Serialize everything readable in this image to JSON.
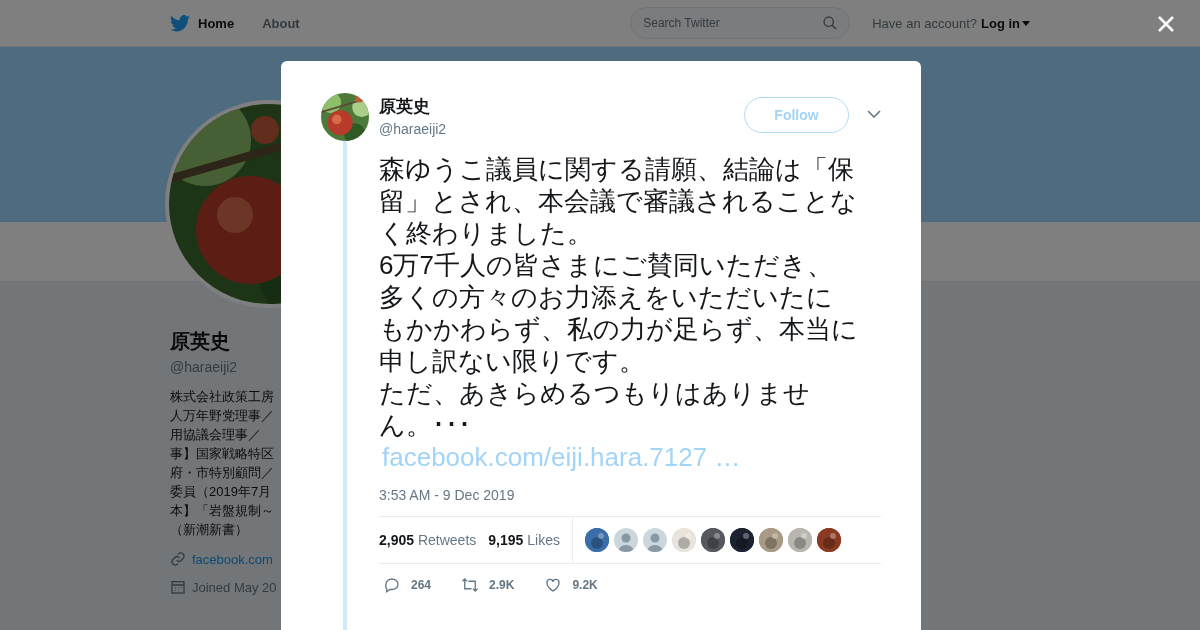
{
  "header": {
    "nav": [
      {
        "label": "Home",
        "selected": true
      },
      {
        "label": "About",
        "selected": false
      }
    ],
    "search": {
      "placeholder": "Search Twitter"
    },
    "account_prompt": "Have an account?",
    "login": "Log in"
  },
  "profile": {
    "name": "原英史",
    "handle": "@haraeiji2",
    "bio_lines": [
      "株式会社政策工房",
      "人万年野党理事／",
      "用協議会理事／",
      "事】国家戦略特区",
      "府・市特別顧問／",
      "委員（2019年7月",
      "本】「岩盤規制～",
      "（新潮新書）"
    ],
    "link": "facebook.com",
    "joined": "Joined May 20"
  },
  "tweet": {
    "name": "原英史",
    "handle": "@haraeiji2",
    "follow": "Follow",
    "paragraphs": [
      "森ゆうこ議員に関する請願、結論は「保",
      "留」とされ、本会議で審議されることな",
      "く終わりました。",
      "6万7千人の皆さまにご賛同いただき、",
      "多くの方々のお力添えをいただいたに",
      "もかかわらず、私の力が足らず、本当に",
      "申し訳ない限りです。",
      "ただ、あきらめるつもりはありませ",
      "ん。･･･"
    ],
    "link": "facebook.com/eiji.hara.7127 …",
    "time": "3:53 AM - 9 Dec 2019",
    "stats": [
      {
        "count": "2,905",
        "label": "Retweets"
      },
      {
        "count": "9,195",
        "label": "Likes"
      }
    ],
    "likers": [
      {
        "kind": "picture",
        "color": "#3a6ea8"
      },
      {
        "kind": "default"
      },
      {
        "kind": "default"
      },
      {
        "kind": "picture",
        "color": "#e8e4dc"
      },
      {
        "kind": "picture",
        "color": "#55585e"
      },
      {
        "kind": "picture",
        "color": "#1c2230"
      },
      {
        "kind": "picture",
        "color": "#a89a84"
      },
      {
        "kind": "picture",
        "color": "#b8b6ae"
      },
      {
        "kind": "picture",
        "color": "#8a3a22"
      }
    ],
    "actions": [
      {
        "kind": "reply",
        "count": "264"
      },
      {
        "kind": "retweet",
        "count": "2.9K"
      },
      {
        "kind": "like",
        "count": "9.2K"
      }
    ]
  }
}
